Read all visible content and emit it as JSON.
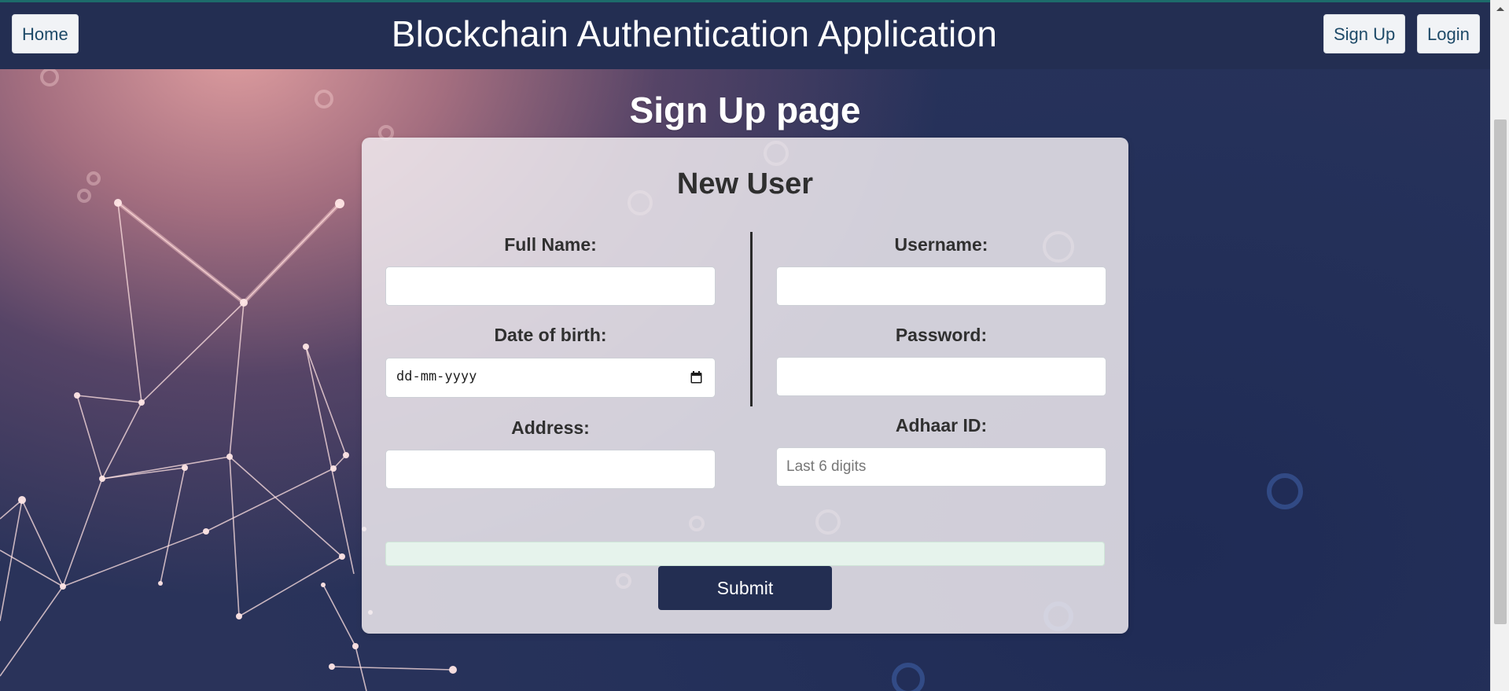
{
  "navbar": {
    "home_label": "Home",
    "title": "Blockchain Authentication Application",
    "signup_label": "Sign Up",
    "login_label": "Login"
  },
  "page": {
    "title": "Sign Up page"
  },
  "form": {
    "title": "New User",
    "left_fields": [
      {
        "label": "Full Name:",
        "value": "",
        "placeholder": ""
      },
      {
        "label": "Date of birth:",
        "value": "dd-mm-yyyy",
        "placeholder": ""
      },
      {
        "label": "Address:",
        "value": "",
        "placeholder": ""
      }
    ],
    "right_fields": [
      {
        "label": "Username:",
        "value": "",
        "placeholder": ""
      },
      {
        "label": "Password:",
        "value": "",
        "placeholder": ""
      },
      {
        "label": "Adhaar ID:",
        "value": "",
        "placeholder": "Last 6 digits"
      }
    ],
    "message": "",
    "submit_label": "Submit"
  },
  "colors": {
    "navbar_bg": "#232e52",
    "accent_line": "#1d6b6b",
    "submit_bg": "#232e52",
    "message_bg": "#e6f3ec"
  },
  "icons": {
    "date_picker": "calendar-icon",
    "scroll": "scroll-up-arrow-icon"
  }
}
